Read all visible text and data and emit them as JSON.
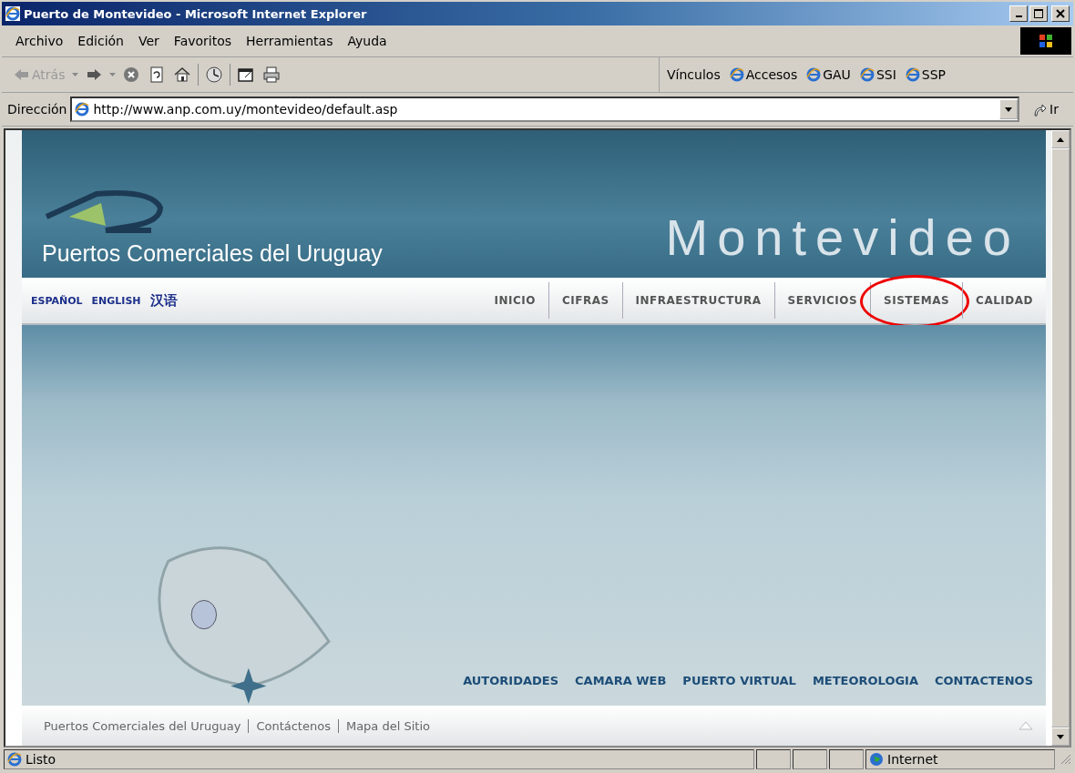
{
  "window": {
    "title": "Puerto de Montevideo - Microsoft Internet Explorer"
  },
  "menu": [
    "Archivo",
    "Edición",
    "Ver",
    "Favoritos",
    "Herramientas",
    "Ayuda"
  ],
  "toolbar": [
    {
      "kind": "back",
      "label": "Atrás",
      "disabled": true
    },
    {
      "kind": "forward",
      "disabled": false
    },
    {
      "kind": "stop"
    },
    {
      "kind": "refresh"
    },
    {
      "kind": "home"
    },
    {
      "kind": "history"
    },
    {
      "kind": "window"
    },
    {
      "kind": "print"
    }
  ],
  "links_bar": {
    "label": "Vínculos",
    "items": [
      "Accesos",
      "GAU",
      "SSI",
      "SSP"
    ]
  },
  "address": {
    "label": "Dirección",
    "value": "http://www.anp.com.uy/montevideo/default.asp",
    "go": "Ir"
  },
  "page": {
    "brand": "Puertos Comerciales del Uruguay",
    "city": "Montevideo",
    "languages": [
      "ESPAÑOL",
      "ENGLISH",
      "汉语"
    ],
    "nav": [
      {
        "label": "INICIO",
        "circled": false
      },
      {
        "label": "CIFRAS",
        "circled": false
      },
      {
        "label": "INFRAESTRUCTURA",
        "circled": false
      },
      {
        "label": "SERVICIOS",
        "circled": false
      },
      {
        "label": "SISTEMAS",
        "circled": true
      },
      {
        "label": "CALIDAD",
        "circled": false
      }
    ],
    "quick_links": [
      "AUTORIDADES",
      "CAMARA WEB",
      "PUERTO VIRTUAL",
      "METEOROLOGIA",
      "CONTACTENOS"
    ],
    "footer_links": [
      "Puertos Comerciales del Uruguay",
      "Contáctenos",
      "Mapa del Sitio"
    ]
  },
  "status_bar": {
    "text": "Listo",
    "zone": "Internet"
  }
}
